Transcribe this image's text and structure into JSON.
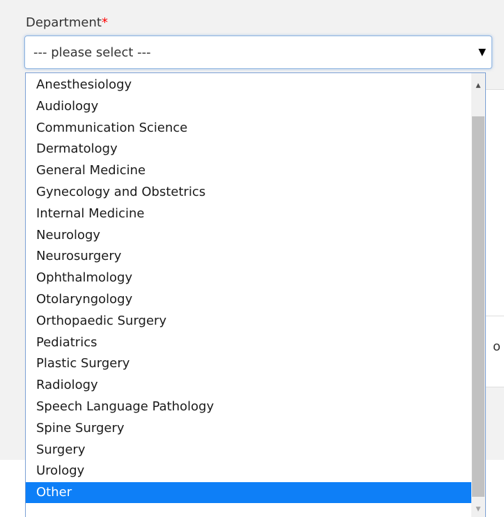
{
  "form": {
    "label": "Department",
    "required_marker": "*",
    "select": {
      "value": "--- please select ---",
      "arrow_icon": "triangle-down",
      "options": [
        {
          "label": "Anesthesiology"
        },
        {
          "label": "Audiology"
        },
        {
          "label": "Communication Science"
        },
        {
          "label": "Dermatology"
        },
        {
          "label": "General Medicine"
        },
        {
          "label": "Gynecology and Obstetrics"
        },
        {
          "label": "Internal Medicine"
        },
        {
          "label": "Neurology"
        },
        {
          "label": "Neurosurgery"
        },
        {
          "label": "Ophthalmology"
        },
        {
          "label": "Otolaryngology"
        },
        {
          "label": "Orthopaedic Surgery"
        },
        {
          "label": "Pediatrics"
        },
        {
          "label": "Plastic Surgery"
        },
        {
          "label": "Radiology"
        },
        {
          "label": "Speech Language Pathology"
        },
        {
          "label": "Spine Surgery"
        },
        {
          "label": "Surgery"
        },
        {
          "label": "Urology"
        },
        {
          "label": "Other"
        }
      ],
      "highlighted_option": "Other"
    }
  },
  "background": {
    "peek_text": "o"
  },
  "colors": {
    "highlight": "#0e7ff7",
    "required": "#ff0000",
    "focus_border": "#8cb3e0"
  },
  "icons": {
    "scroll_up": "scroll-up-arrow",
    "scroll_down": "scroll-down-arrow"
  }
}
